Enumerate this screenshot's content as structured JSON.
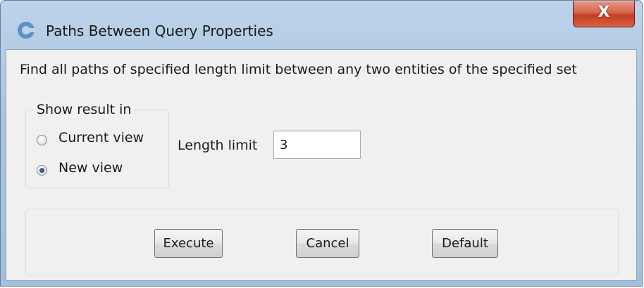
{
  "window": {
    "title": "Paths Between Query Properties",
    "close_label": "X"
  },
  "description": "Find all paths of specified length limit between any two entities of the specified set",
  "show_result": {
    "group_label": "Show result in",
    "options": [
      {
        "label": "Current view",
        "selected": false
      },
      {
        "label": "New view",
        "selected": true
      }
    ]
  },
  "length_limit": {
    "label": "Length limit",
    "value": "3"
  },
  "buttons": {
    "execute": "Execute",
    "cancel": "Cancel",
    "default": "Default"
  },
  "icons": {
    "app": "app-logo-icon",
    "close": "close-icon"
  },
  "colors": {
    "titlebar": "#aac4e0",
    "close_button": "#c33f25",
    "client_background": "#f0f0f0"
  }
}
